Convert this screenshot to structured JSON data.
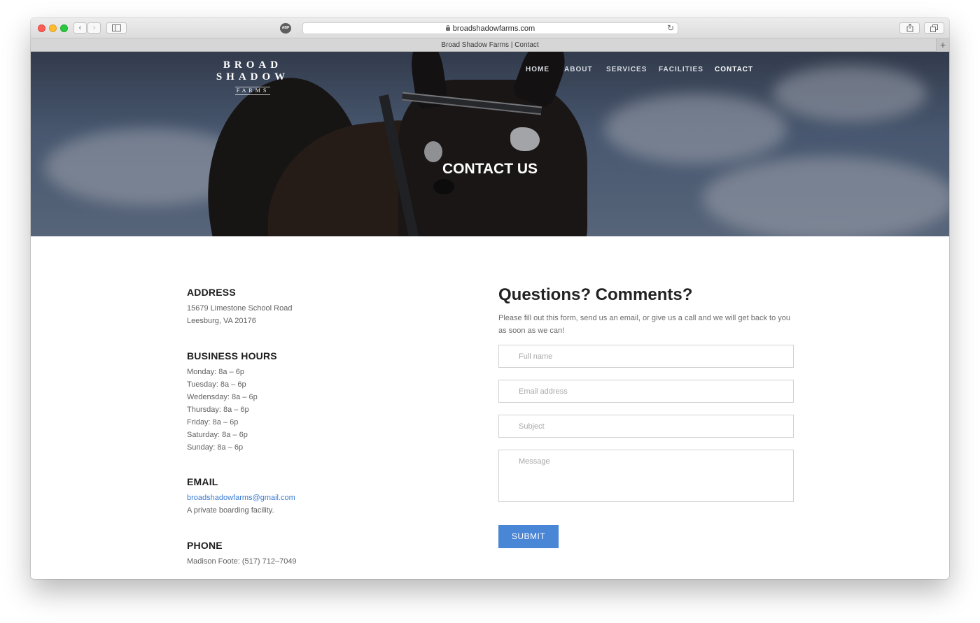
{
  "browser": {
    "url": "broadshadowfarms.com",
    "tab_title": "Broad Shadow Farms | Contact",
    "new_tab": "+",
    "adblock": "ABP"
  },
  "site": {
    "logo_main": "BROAD SHADOW",
    "logo_sub": "FARMS",
    "nav": [
      {
        "label": "HOME",
        "active": false
      },
      {
        "label": "ABOUT",
        "active": false
      },
      {
        "label": "SERVICES",
        "active": false
      },
      {
        "label": "FACILITIES",
        "active": false
      },
      {
        "label": "CONTACT",
        "active": true
      }
    ],
    "hero_title": "CONTACT US"
  },
  "contact": {
    "address": {
      "heading": "ADDRESS",
      "lines": [
        "15679 Limestone School Road",
        "Leesburg, VA 20176"
      ]
    },
    "hours": {
      "heading": "BUSINESS HOURS",
      "lines": [
        "Monday: 8a – 6p",
        "Tuesday: 8a – 6p",
        "Wedensday: 8a – 6p",
        "Thursday: 8a – 6p",
        "Friday: 8a – 6p",
        "Saturday: 8a – 6p",
        "Sunday: 8a – 6p"
      ]
    },
    "email": {
      "heading": "EMAIL",
      "address": "broadshadowfarms@gmail.com",
      "note": "A private boarding facility."
    },
    "phone": {
      "heading": "PHONE",
      "line": "Madison Foote: (517) 712–7049"
    }
  },
  "form": {
    "title": "Questions? Comments?",
    "description": "Please fill out this form, send us an email, or give us a call and we will get back to you as soon as we can!",
    "fields": {
      "name_placeholder": "Full name",
      "email_placeholder": "Email address",
      "subject_placeholder": "Subject",
      "message_placeholder": "Message"
    },
    "submit_label": "SUBMIT"
  },
  "colors": {
    "accent": "#4a86d6",
    "link": "#3b7bd1",
    "heading": "#1e1e1e",
    "body_text": "#616161"
  }
}
